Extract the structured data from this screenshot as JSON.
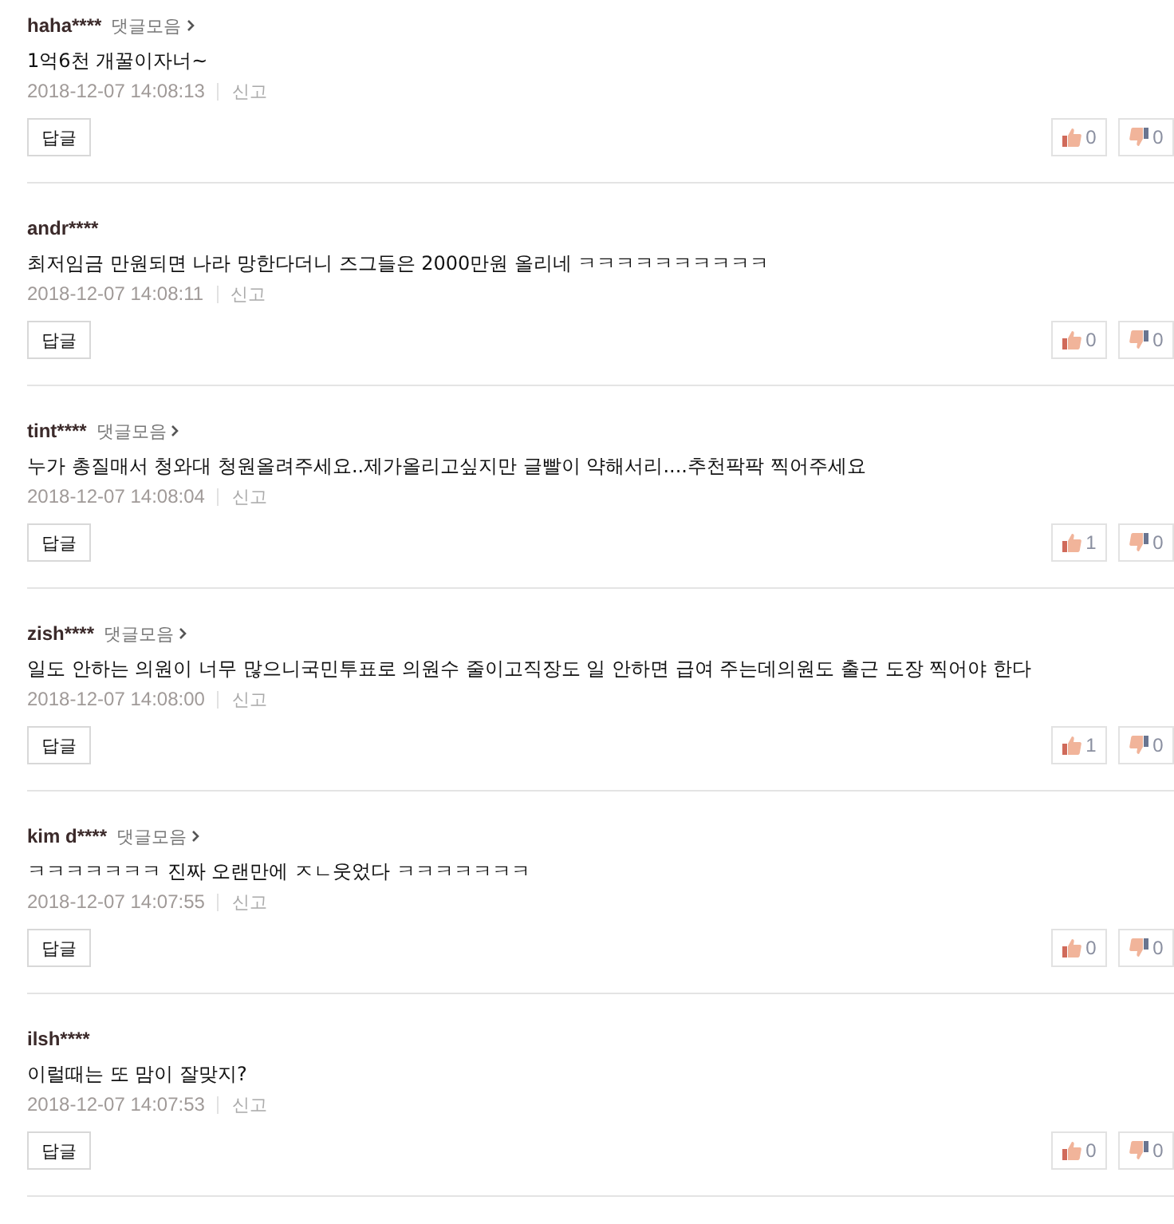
{
  "comments": [
    {
      "user": "haha****",
      "collection_link": "댓글모음",
      "text": "1억6천 개꿀이자너~",
      "time": "2018-12-07 14:08:13",
      "report": "신고",
      "reply": "답글",
      "likes": "0",
      "dislikes": "0"
    },
    {
      "user": "andr****",
      "text": "최저임금 만원되면 나라 망한다더니 즈그들은 2000만원 올리네 ㅋㅋㅋㅋㅋㅋㅋㅋㅋㅋ",
      "time": "2018-12-07 14:08:11",
      "report": "신고",
      "reply": "답글",
      "likes": "0",
      "dislikes": "0"
    },
    {
      "user": "tint****",
      "collection_link": "댓글모음",
      "text": "누가 총질매서 청와대 청원올려주세요..제가올리고싶지만 글빨이 약해서리....추천팍팍 찍어주세요",
      "time": "2018-12-07 14:08:04",
      "report": "신고",
      "reply": "답글",
      "likes": "1",
      "dislikes": "0"
    },
    {
      "user": "zish****",
      "collection_link": "댓글모음",
      "text": "일도 안하는 의원이 너무 많으니국민투표로 의원수 줄이고직장도 일 안하면 급여 주는데의원도 출근 도장 찍어야 한다",
      "time": "2018-12-07 14:08:00",
      "report": "신고",
      "reply": "답글",
      "likes": "1",
      "dislikes": "0"
    },
    {
      "user": "kim d****",
      "collection_link": "댓글모음",
      "text": "ㅋㅋㅋㅋㅋㅋㅋ 진짜 오랜만에 ㅈㄴ웃었다 ㅋㅋㅋㅋㅋㅋㅋ",
      "time": "2018-12-07 14:07:55",
      "report": "신고",
      "reply": "답글",
      "likes": "0",
      "dislikes": "0"
    },
    {
      "user": "ilsh****",
      "text": "이럴때는 또 맘이 잘맞지?",
      "time": "2018-12-07 14:07:53",
      "report": "신고",
      "reply": "답글",
      "likes": "0",
      "dislikes": "0"
    }
  ]
}
